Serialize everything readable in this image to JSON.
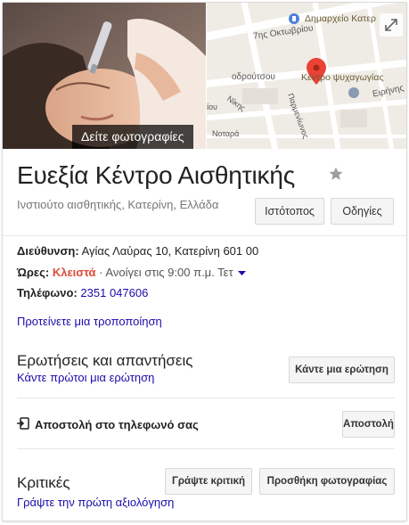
{
  "business": {
    "name": "Ευεξία Κέντρο Αισθητικής",
    "category_location": "Ινστιούτο αισθητικής, Κατερίνη, Ελλάδα"
  },
  "hero": {
    "photos_button": "Δείτε φωτογραφίες",
    "map_labels": {
      "city_hall": "Δημαρχείο Κατερ",
      "street_oktovriou": "7ης Οκτωβρίου",
      "street_partial": "οδρούτσου",
      "center": "Κέντρο ψυχαγωγίας",
      "eirinis": "Ειρήνης",
      "nikis": "Νίκης",
      "notara": "Νοταρά",
      "parmenionos": "Παρμενίωνος",
      "partial_left": "ίου"
    },
    "expand_icon": "expand-icon"
  },
  "actions": {
    "website": "Ιστότοπος",
    "directions": "Οδηγίες"
  },
  "info": {
    "address_label": "Διεύθυνση:",
    "address_value": "Αγίας Λαύρας 10, Κατερίνη 601 00",
    "hours_label": "Ώρες:",
    "hours_status": "Κλειστά",
    "hours_sep": " · ",
    "hours_next": "Ανοίγει στις 9:00 π.μ. Τετ",
    "phone_label": "Τηλέφωνο:",
    "phone_value": "2351 047606",
    "suggest_edit": "Προτείνετε μια τροποποίηση"
  },
  "qa": {
    "title": "Ερωτήσεις και απαντήσεις",
    "link": "Κάντε πρώτοι μια ερώτηση",
    "button": "Κάντε μια ερώτηση"
  },
  "send": {
    "label": "Αποστολή στο τηλεφωνό σας",
    "button": "Αποστολή"
  },
  "reviews": {
    "title": "Κριτικές",
    "link": "Γράψτε την πρώτη αξιολόγηση",
    "write_button": "Γράψτε κριτική",
    "add_photo_button": "Προσθήκη φωτογραφίας"
  },
  "colors": {
    "link": "#1a0dab",
    "closed": "#dd4b39",
    "map_pin": "#ea4335"
  }
}
